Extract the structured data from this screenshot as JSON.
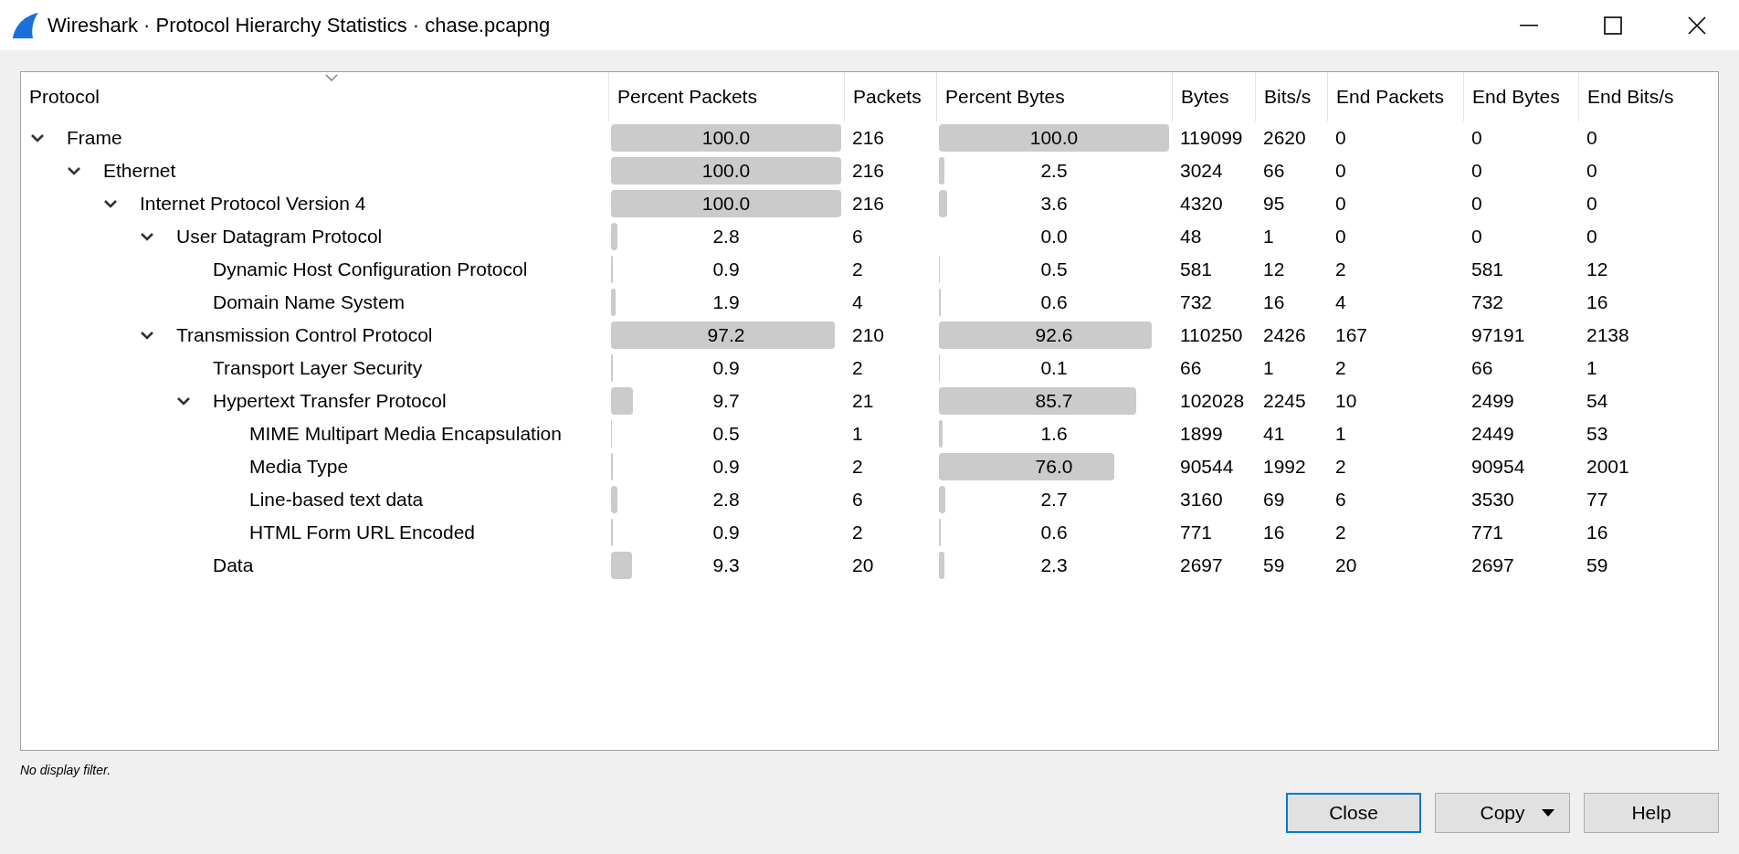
{
  "window": {
    "title": "Wireshark · Protocol Hierarchy Statistics · chase.pcapng"
  },
  "table": {
    "columns": [
      "Protocol",
      "Percent Packets",
      "Packets",
      "Percent Bytes",
      "Bytes",
      "Bits/s",
      "End Packets",
      "End Bytes",
      "End Bits/s"
    ],
    "rows": [
      {
        "protocol": "Frame",
        "expanded": true,
        "percent_packets": {
          "text": "100.0",
          "level": 1.0
        },
        "packets": "216",
        "percent_bytes": {
          "text": "100.0",
          "level": 1.0
        },
        "bytes": "119099",
        "bits_s": "2620",
        "end_packets": "0",
        "end_bytes": "0",
        "end_bits_s": "0",
        "children": [
          {
            "protocol": "Ethernet",
            "expanded": true,
            "percent_packets": {
              "text": "100.0",
              "level": 1.0
            },
            "packets": "216",
            "percent_bytes": {
              "text": "2.5",
              "level": 0.025
            },
            "bytes": "3024",
            "bits_s": "66",
            "end_packets": "0",
            "end_bytes": "0",
            "end_bits_s": "0",
            "children": [
              {
                "protocol": "Internet Protocol Version 4",
                "expanded": true,
                "percent_packets": {
                  "text": "100.0",
                  "level": 1.0
                },
                "packets": "216",
                "percent_bytes": {
                  "text": "3.6",
                  "level": 0.036
                },
                "bytes": "4320",
                "bits_s": "95",
                "end_packets": "0",
                "end_bytes": "0",
                "end_bits_s": "0",
                "children": [
                  {
                    "protocol": "User Datagram Protocol",
                    "expanded": true,
                    "percent_packets": {
                      "text": "2.8",
                      "level": 0.028
                    },
                    "packets": "6",
                    "percent_bytes": {
                      "text": "0.0"
                    },
                    "bytes": "48",
                    "bits_s": "1",
                    "end_packets": "0",
                    "end_bytes": "0",
                    "end_bits_s": "0",
                    "children": [
                      {
                        "protocol": "Dynamic Host Configuration Protocol",
                        "percent_packets": {
                          "text": "0.9",
                          "level": 0.009
                        },
                        "packets": "2",
                        "percent_bytes": {
                          "text": "0.5",
                          "level": 0.005
                        },
                        "bytes": "581",
                        "bits_s": "12",
                        "end_packets": "2",
                        "end_bytes": "581",
                        "end_bits_s": "12"
                      },
                      {
                        "protocol": "Domain Name System",
                        "percent_packets": {
                          "text": "1.9",
                          "level": 0.019
                        },
                        "packets": "4",
                        "percent_bytes": {
                          "text": "0.6",
                          "level": 0.006
                        },
                        "bytes": "732",
                        "bits_s": "16",
                        "end_packets": "4",
                        "end_bytes": "732",
                        "end_bits_s": "16"
                      }
                    ]
                  },
                  {
                    "protocol": "Transmission Control Protocol",
                    "expanded": true,
                    "percent_packets": {
                      "text": "97.2",
                      "level": 0.972
                    },
                    "packets": "210",
                    "percent_bytes": {
                      "text": "92.6",
                      "level": 0.926
                    },
                    "bytes": "110250",
                    "bits_s": "2426",
                    "end_packets": "167",
                    "end_bytes": "97191",
                    "end_bits_s": "2138",
                    "children": [
                      {
                        "protocol": "Transport Layer Security",
                        "percent_packets": {
                          "text": "0.9",
                          "level": 0.009
                        },
                        "packets": "2",
                        "percent_bytes": {
                          "text": "0.1",
                          "level": 0.001
                        },
                        "bytes": "66",
                        "bits_s": "1",
                        "end_packets": "2",
                        "end_bytes": "66",
                        "end_bits_s": "1"
                      },
                      {
                        "protocol": "Hypertext Transfer Protocol",
                        "expanded": true,
                        "percent_packets": {
                          "text": "9.7",
                          "level": 0.097
                        },
                        "packets": "21",
                        "percent_bytes": {
                          "text": "85.7",
                          "level": 0.857
                        },
                        "bytes": "102028",
                        "bits_s": "2245",
                        "end_packets": "10",
                        "end_bytes": "2499",
                        "end_bits_s": "54",
                        "children": [
                          {
                            "protocol": "MIME Multipart Media Encapsulation",
                            "percent_packets": {
                              "text": "0.5",
                              "level": 0.005
                            },
                            "packets": "1",
                            "percent_bytes": {
                              "text": "1.6",
                              "level": 0.016
                            },
                            "bytes": "1899",
                            "bits_s": "41",
                            "end_packets": "1",
                            "end_bytes": "2449",
                            "end_bits_s": "53"
                          },
                          {
                            "protocol": "Media Type",
                            "percent_packets": {
                              "text": "0.9",
                              "level": 0.009
                            },
                            "packets": "2",
                            "percent_bytes": {
                              "text": "76.0",
                              "level": 0.76
                            },
                            "bytes": "90544",
                            "bits_s": "1992",
                            "end_packets": "2",
                            "end_bytes": "90954",
                            "end_bits_s": "2001"
                          },
                          {
                            "protocol": "Line-based text data",
                            "percent_packets": {
                              "text": "2.8",
                              "level": 0.028
                            },
                            "packets": "6",
                            "percent_bytes": {
                              "text": "2.7",
                              "level": 0.027
                            },
                            "bytes": "3160",
                            "bits_s": "69",
                            "end_packets": "6",
                            "end_bytes": "3530",
                            "end_bits_s": "77"
                          },
                          {
                            "protocol": "HTML Form URL Encoded",
                            "percent_packets": {
                              "text": "0.9",
                              "level": 0.009
                            },
                            "packets": "2",
                            "percent_bytes": {
                              "text": "0.6",
                              "level": 0.006
                            },
                            "bytes": "771",
                            "bits_s": "16",
                            "end_packets": "2",
                            "end_bytes": "771",
                            "end_bits_s": "16"
                          }
                        ]
                      },
                      {
                        "protocol": "Data",
                        "percent_packets": {
                          "text": "9.3",
                          "level": 0.093
                        },
                        "packets": "20",
                        "percent_bytes": {
                          "text": "2.3",
                          "level": 0.023
                        },
                        "bytes": "2697",
                        "bits_s": "59",
                        "end_packets": "20",
                        "end_bytes": "2697",
                        "end_bits_s": "59"
                      }
                    ]
                  }
                ]
              }
            ]
          }
        ]
      }
    ]
  },
  "status": "No display filter.",
  "buttons": [
    {
      "label": "Close",
      "focused": true,
      "dropdown": false
    },
    {
      "label": "Copy",
      "focused": false,
      "dropdown": true
    },
    {
      "label": "Help",
      "focused": false,
      "dropdown": false
    }
  ]
}
